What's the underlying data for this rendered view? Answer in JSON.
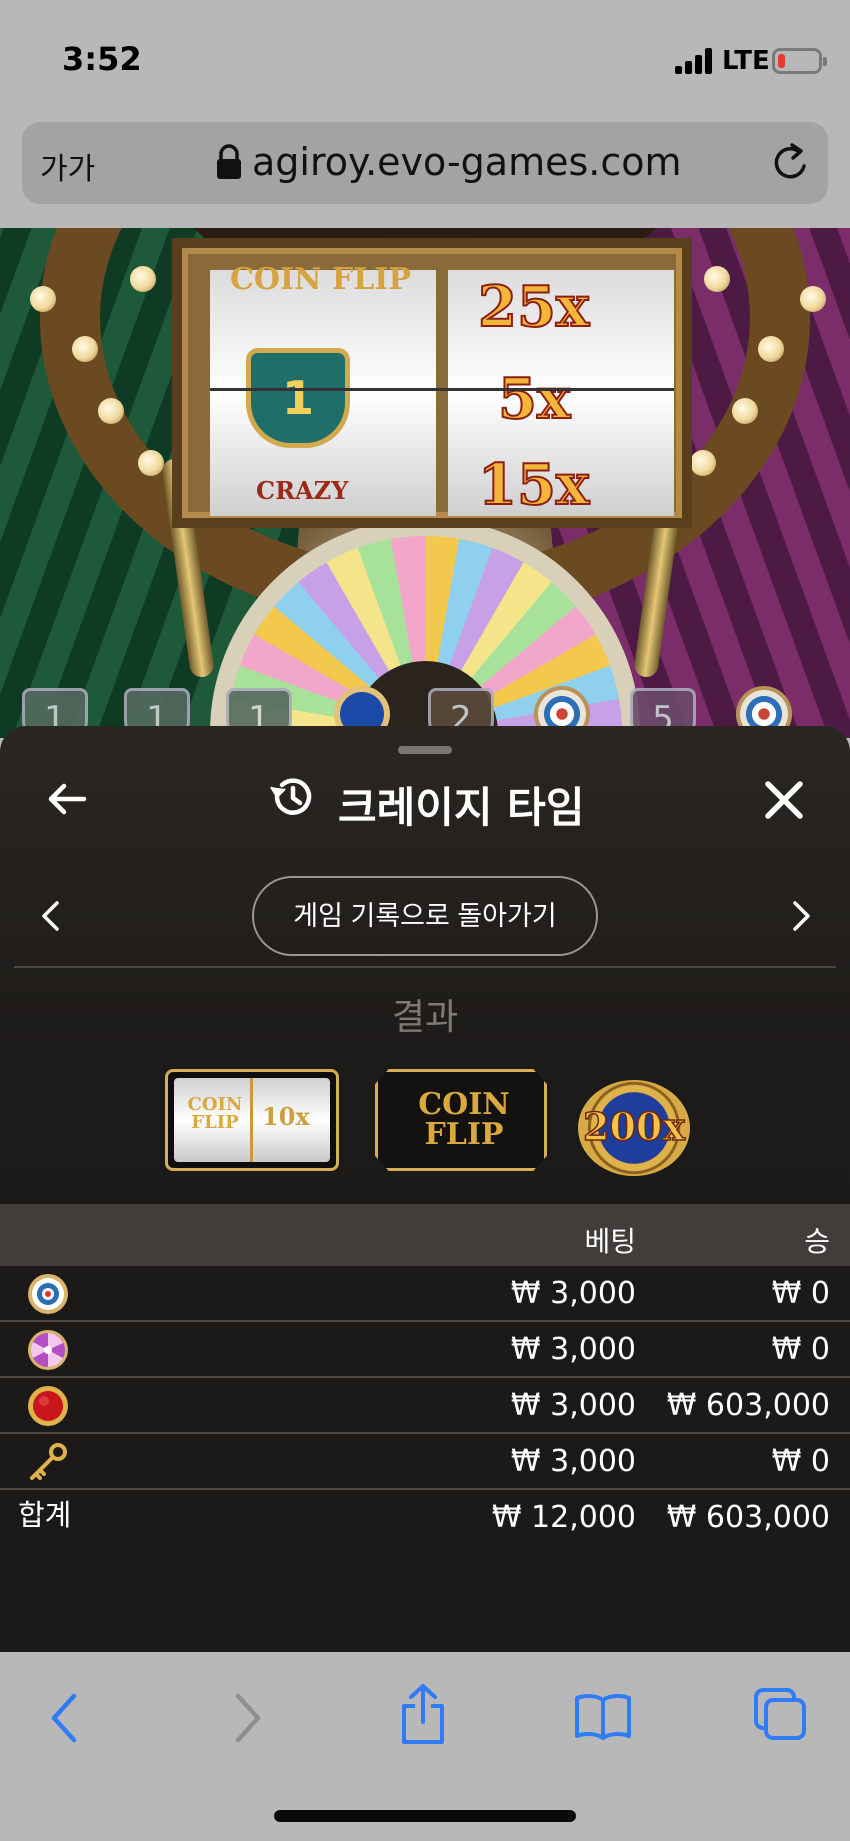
{
  "status_bar": {
    "time": "3:52",
    "network": "LTE"
  },
  "browser": {
    "text_size_button": "가가",
    "url": "agiroy.evo-games.com",
    "lock_icon": "lock-icon",
    "reload_icon": "reload-icon"
  },
  "game": {
    "slot_left_label_top": "COIN FLIP",
    "slot_left_shield_number": "1",
    "slot_left_label_bottom": "CRAZY",
    "slot_multipliers": [
      "25x",
      "5x",
      "15x"
    ],
    "segment_badges": [
      "1",
      "1",
      "1",
      "2",
      "5"
    ]
  },
  "sheet": {
    "title": "크레이지 타임",
    "back_icon": "arrow-left-icon",
    "history_icon": "history-icon",
    "close_icon": "close-icon",
    "back_to_history_button": "게임 기록으로 돌아가기",
    "prev_icon": "chevron-left-icon",
    "next_icon": "chevron-right-icon",
    "result_label": "결과",
    "results": {
      "slot_left": "COIN FLIP",
      "slot_right": "10x",
      "segment": "COIN FLIP",
      "multiplier": "200x"
    }
  },
  "bet_table": {
    "headers": {
      "bet": "베팅",
      "win": "승"
    },
    "rows": [
      {
        "icon": "cash-hunt-target-icon",
        "bet": "₩ 3,000",
        "win": "₩ 0"
      },
      {
        "icon": "pachinko-candy-icon",
        "bet": "₩ 3,000",
        "win": "₩ 0"
      },
      {
        "icon": "coin-flip-red-icon",
        "bet": "₩ 3,000",
        "win": "₩ 603,000"
      },
      {
        "icon": "key-icon",
        "bet": "₩ 3,000",
        "win": "₩ 0"
      }
    ],
    "total": {
      "label": "합계",
      "bet": "₩ 12,000",
      "win": "₩ 603,000"
    }
  },
  "toolbar": {
    "icons": [
      "back-icon",
      "forward-icon",
      "share-icon",
      "bookmarks-icon",
      "tabs-icon"
    ],
    "accent_color": "#2f7cf6",
    "disabled_color": "#8e8e93"
  },
  "colors": {
    "chrome_gray": "#b8b8b8",
    "sheet_background": "#1d1b19",
    "gold": "#d6ae55",
    "battery_low": "#e53a2c"
  }
}
